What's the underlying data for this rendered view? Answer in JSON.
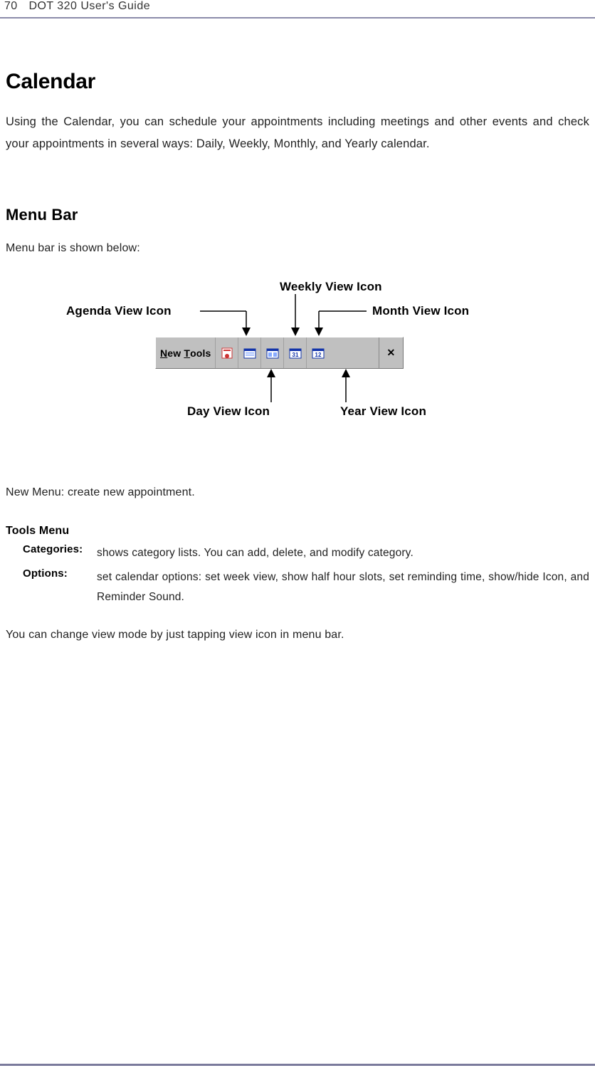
{
  "header": {
    "page_number": "70",
    "doc_title": "DOT 320 User's Guide"
  },
  "section": {
    "title": "Calendar",
    "intro": "Using the Calendar, you can schedule your appointments including meetings and other events and check your appointments in several ways: Daily, Weekly, Monthly, and Yearly calendar."
  },
  "menubar": {
    "heading": "Menu Bar",
    "shown_below": "Menu bar is shown below:",
    "labels": {
      "agenda": "Agenda View Icon",
      "day": "Day View Icon",
      "weekly": "Weekly View Icon",
      "month": "Month View Icon",
      "year": "Year View Icon"
    },
    "toolbar": {
      "menu_new_underline": "N",
      "menu_new_rest": "ew",
      "menu_tools_underline": "T",
      "menu_tools_rest": "ools",
      "close": "✕"
    }
  },
  "new_menu_text": "New Menu: create new appointment.",
  "tools_menu": {
    "heading": "Tools Menu",
    "items": [
      {
        "term": "Categories:",
        "desc": "shows category lists. You can add, delete, and modify category."
      },
      {
        "term": "Options:",
        "desc": "set calendar options: set week view, show half hour slots, set reminding time, show/hide Icon, and Reminder Sound."
      }
    ]
  },
  "final_text": "You can change view mode by just tapping view icon in menu bar."
}
